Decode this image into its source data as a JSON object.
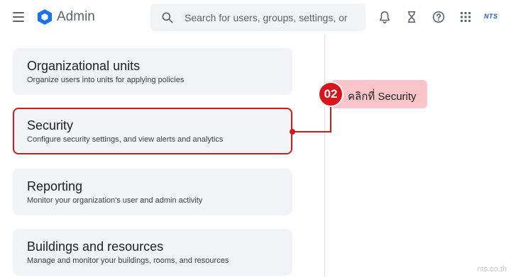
{
  "header": {
    "app_title": "Admin",
    "search_placeholder": "Search for users, groups, settings, or",
    "brand": "NTS",
    "icons": [
      "menu-icon",
      "admin-logo-icon",
      "search-icon",
      "notifications-bell-icon",
      "tasks-hourglass-icon",
      "help-icon",
      "apps-grid-icon"
    ]
  },
  "cards": [
    {
      "title": "Organizational units",
      "description": "Organize users into units for applying policies"
    },
    {
      "title": "Security",
      "description": "Configure security settings, and view alerts and analytics"
    },
    {
      "title": "Reporting",
      "description": "Monitor your organization's user and admin activity"
    },
    {
      "title": "Buildings and resources",
      "description": "Manage and monitor your buildings, rooms, and resources"
    }
  ],
  "annotation": {
    "step": "02",
    "text": "คลิกที่ Security"
  },
  "colors": {
    "highlight": "#d11a1a",
    "callout_bg": "#fbc4c9",
    "card_bg": "#f1f3f6",
    "brand_blue": "#1a56c9"
  },
  "watermark": "nts.co.th"
}
